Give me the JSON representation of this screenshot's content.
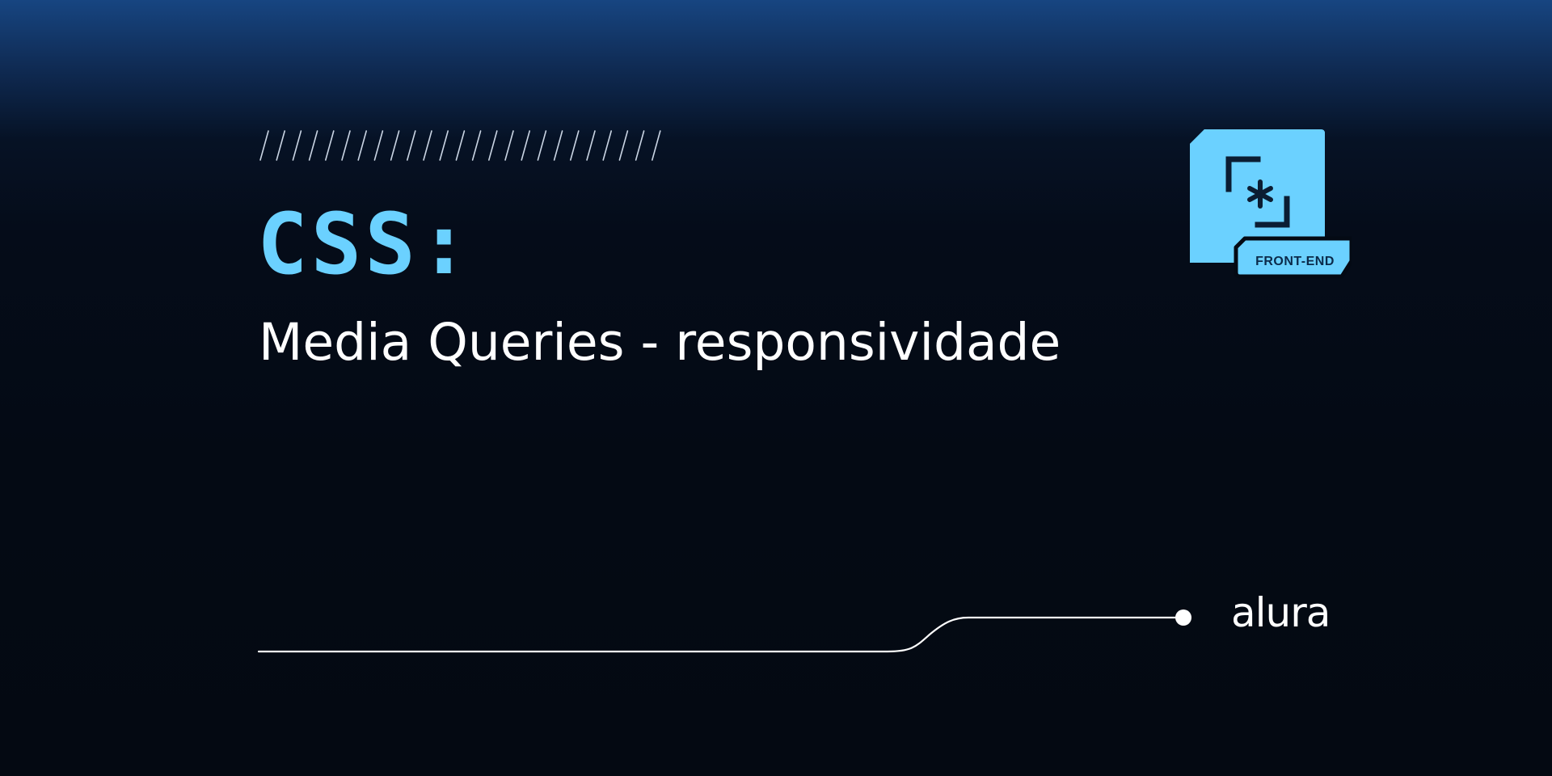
{
  "header": {
    "category": "CSS:",
    "course_title": "Media Queries - responsividade"
  },
  "badge": {
    "label": "FRONT-END",
    "icon": "css-selector-icon",
    "color": "#6bd1ff"
  },
  "brand": {
    "name": "alura"
  },
  "colors": {
    "accent": "#6bd1ff",
    "background_top": "#174581",
    "background_bottom": "#040a14",
    "text": "#ffffff"
  }
}
